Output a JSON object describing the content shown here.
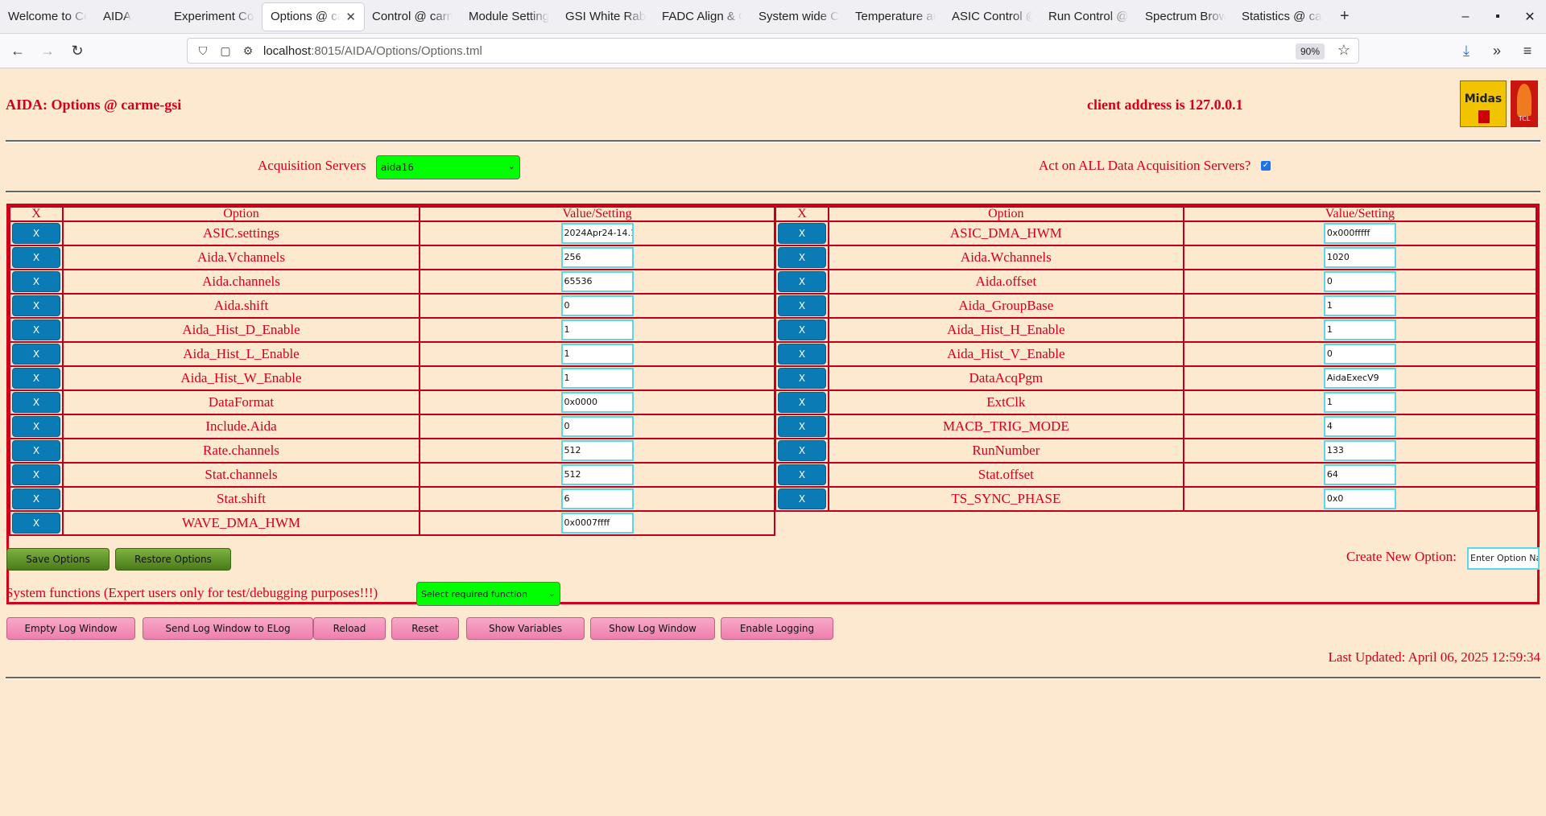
{
  "browser": {
    "tabs": [
      {
        "label": "Welcome to Ce",
        "active": false
      },
      {
        "label": "AIDA",
        "active": false
      },
      {
        "label": "Experiment Con",
        "active": false
      },
      {
        "label": "Options @ ca",
        "active": true
      },
      {
        "label": "Control @ carm",
        "active": false
      },
      {
        "label": "Module Settings",
        "active": false
      },
      {
        "label": "GSI White Rabb",
        "active": false
      },
      {
        "label": "FADC Align & C",
        "active": false
      },
      {
        "label": "System wide Ch",
        "active": false
      },
      {
        "label": "Temperature an",
        "active": false
      },
      {
        "label": "ASIC Control @",
        "active": false
      },
      {
        "label": "Run Control @ c",
        "active": false
      },
      {
        "label": "Spectrum Brow",
        "active": false
      },
      {
        "label": "Statistics @ car",
        "active": false
      }
    ],
    "new_tab": "+",
    "url_host": "localhost",
    "url_path": ":8015/AIDA/Options/Options.tml",
    "zoom": "90%"
  },
  "page": {
    "title": "AIDA: Options @ carme-gsi",
    "client_address": "client address is 127.0.0.1",
    "logo_midas": "Midas",
    "logo_tcl": "TCL",
    "acq_label": "Acquisition Servers",
    "acq_selected": "aida16",
    "act_all_label": "Act on ALL Data Acquisition Servers?",
    "act_all_checked": true,
    "headers": {
      "x": "X",
      "option": "Option",
      "value": "Value/Setting"
    },
    "left_options": [
      {
        "name": "ASIC.settings",
        "value": "2024Apr24-14.1"
      },
      {
        "name": "Aida.Vchannels",
        "value": "256"
      },
      {
        "name": "Aida.channels",
        "value": "65536"
      },
      {
        "name": "Aida.shift",
        "value": "0"
      },
      {
        "name": "Aida_Hist_D_Enable",
        "value": "1"
      },
      {
        "name": "Aida_Hist_L_Enable",
        "value": "1"
      },
      {
        "name": "Aida_Hist_W_Enable",
        "value": "1"
      },
      {
        "name": "DataFormat",
        "value": "0x0000"
      },
      {
        "name": "Include.Aida",
        "value": "0"
      },
      {
        "name": "Rate.channels",
        "value": "512"
      },
      {
        "name": "Stat.channels",
        "value": "512"
      },
      {
        "name": "Stat.shift",
        "value": "6"
      },
      {
        "name": "WAVE_DMA_HWM",
        "value": "0x0007ffff"
      }
    ],
    "right_options": [
      {
        "name": "ASIC_DMA_HWM",
        "value": "0x000fffff"
      },
      {
        "name": "Aida.Wchannels",
        "value": "1020"
      },
      {
        "name": "Aida.offset",
        "value": "0"
      },
      {
        "name": "Aida_GroupBase",
        "value": "1"
      },
      {
        "name": "Aida_Hist_H_Enable",
        "value": "1"
      },
      {
        "name": "Aida_Hist_V_Enable",
        "value": "0"
      },
      {
        "name": "DataAcqPgm",
        "value": "AidaExecV9"
      },
      {
        "name": "ExtClk",
        "value": "1"
      },
      {
        "name": "MACB_TRIG_MODE",
        "value": "4"
      },
      {
        "name": "RunNumber",
        "value": "133"
      },
      {
        "name": "Stat.offset",
        "value": "64"
      },
      {
        "name": "TS_SYNC_PHASE",
        "value": "0x0"
      }
    ],
    "x_button_label": "X",
    "save_options": "Save Options",
    "restore_options": "Restore Options",
    "create_new_option_label": "Create New Option:",
    "create_new_option_placeholder": "Enter Option Na",
    "system_functions_label": "System functions (Expert users only for test/debugging purposes!!!)",
    "system_function_selected": "Select required function",
    "pink_buttons": [
      "Empty Log Window",
      "Send Log Window to ELog",
      "Reload",
      "Reset",
      "Show Variables",
      "Show Log Window",
      "Enable Logging"
    ],
    "last_updated": "Last Updated: April 06, 2025 12:59:34"
  }
}
